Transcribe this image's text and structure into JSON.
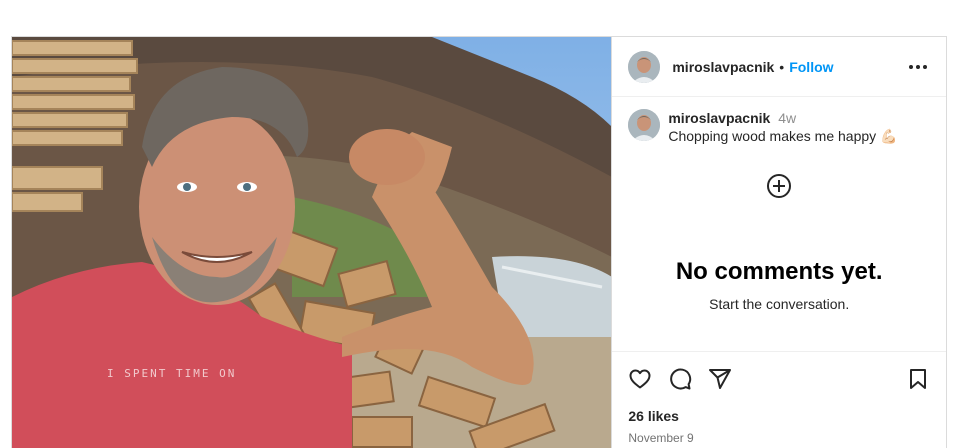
{
  "post": {
    "username": "miroslavpacnik",
    "separator": "•",
    "follow_label": "Follow",
    "caption_username": "miroslavpacnik",
    "caption_time": "4w",
    "caption_text": "Chopping wood makes me happy 💪🏻",
    "shirt_text": "I SPENT TIME ON",
    "empty_title": "No comments yet.",
    "empty_subtitle": "Start the conversation.",
    "likes": "26 likes",
    "date": "November 9"
  },
  "icons": {
    "more": "more-horizontal-icon",
    "add_comment": "plus-circle-icon",
    "like": "heart-icon",
    "comment": "comment-icon",
    "share": "share-icon",
    "save": "bookmark-icon"
  },
  "colors": {
    "accent": "#0095f6",
    "text": "#262626",
    "muted": "#8e8e8e",
    "border": "#dbdbdb"
  }
}
